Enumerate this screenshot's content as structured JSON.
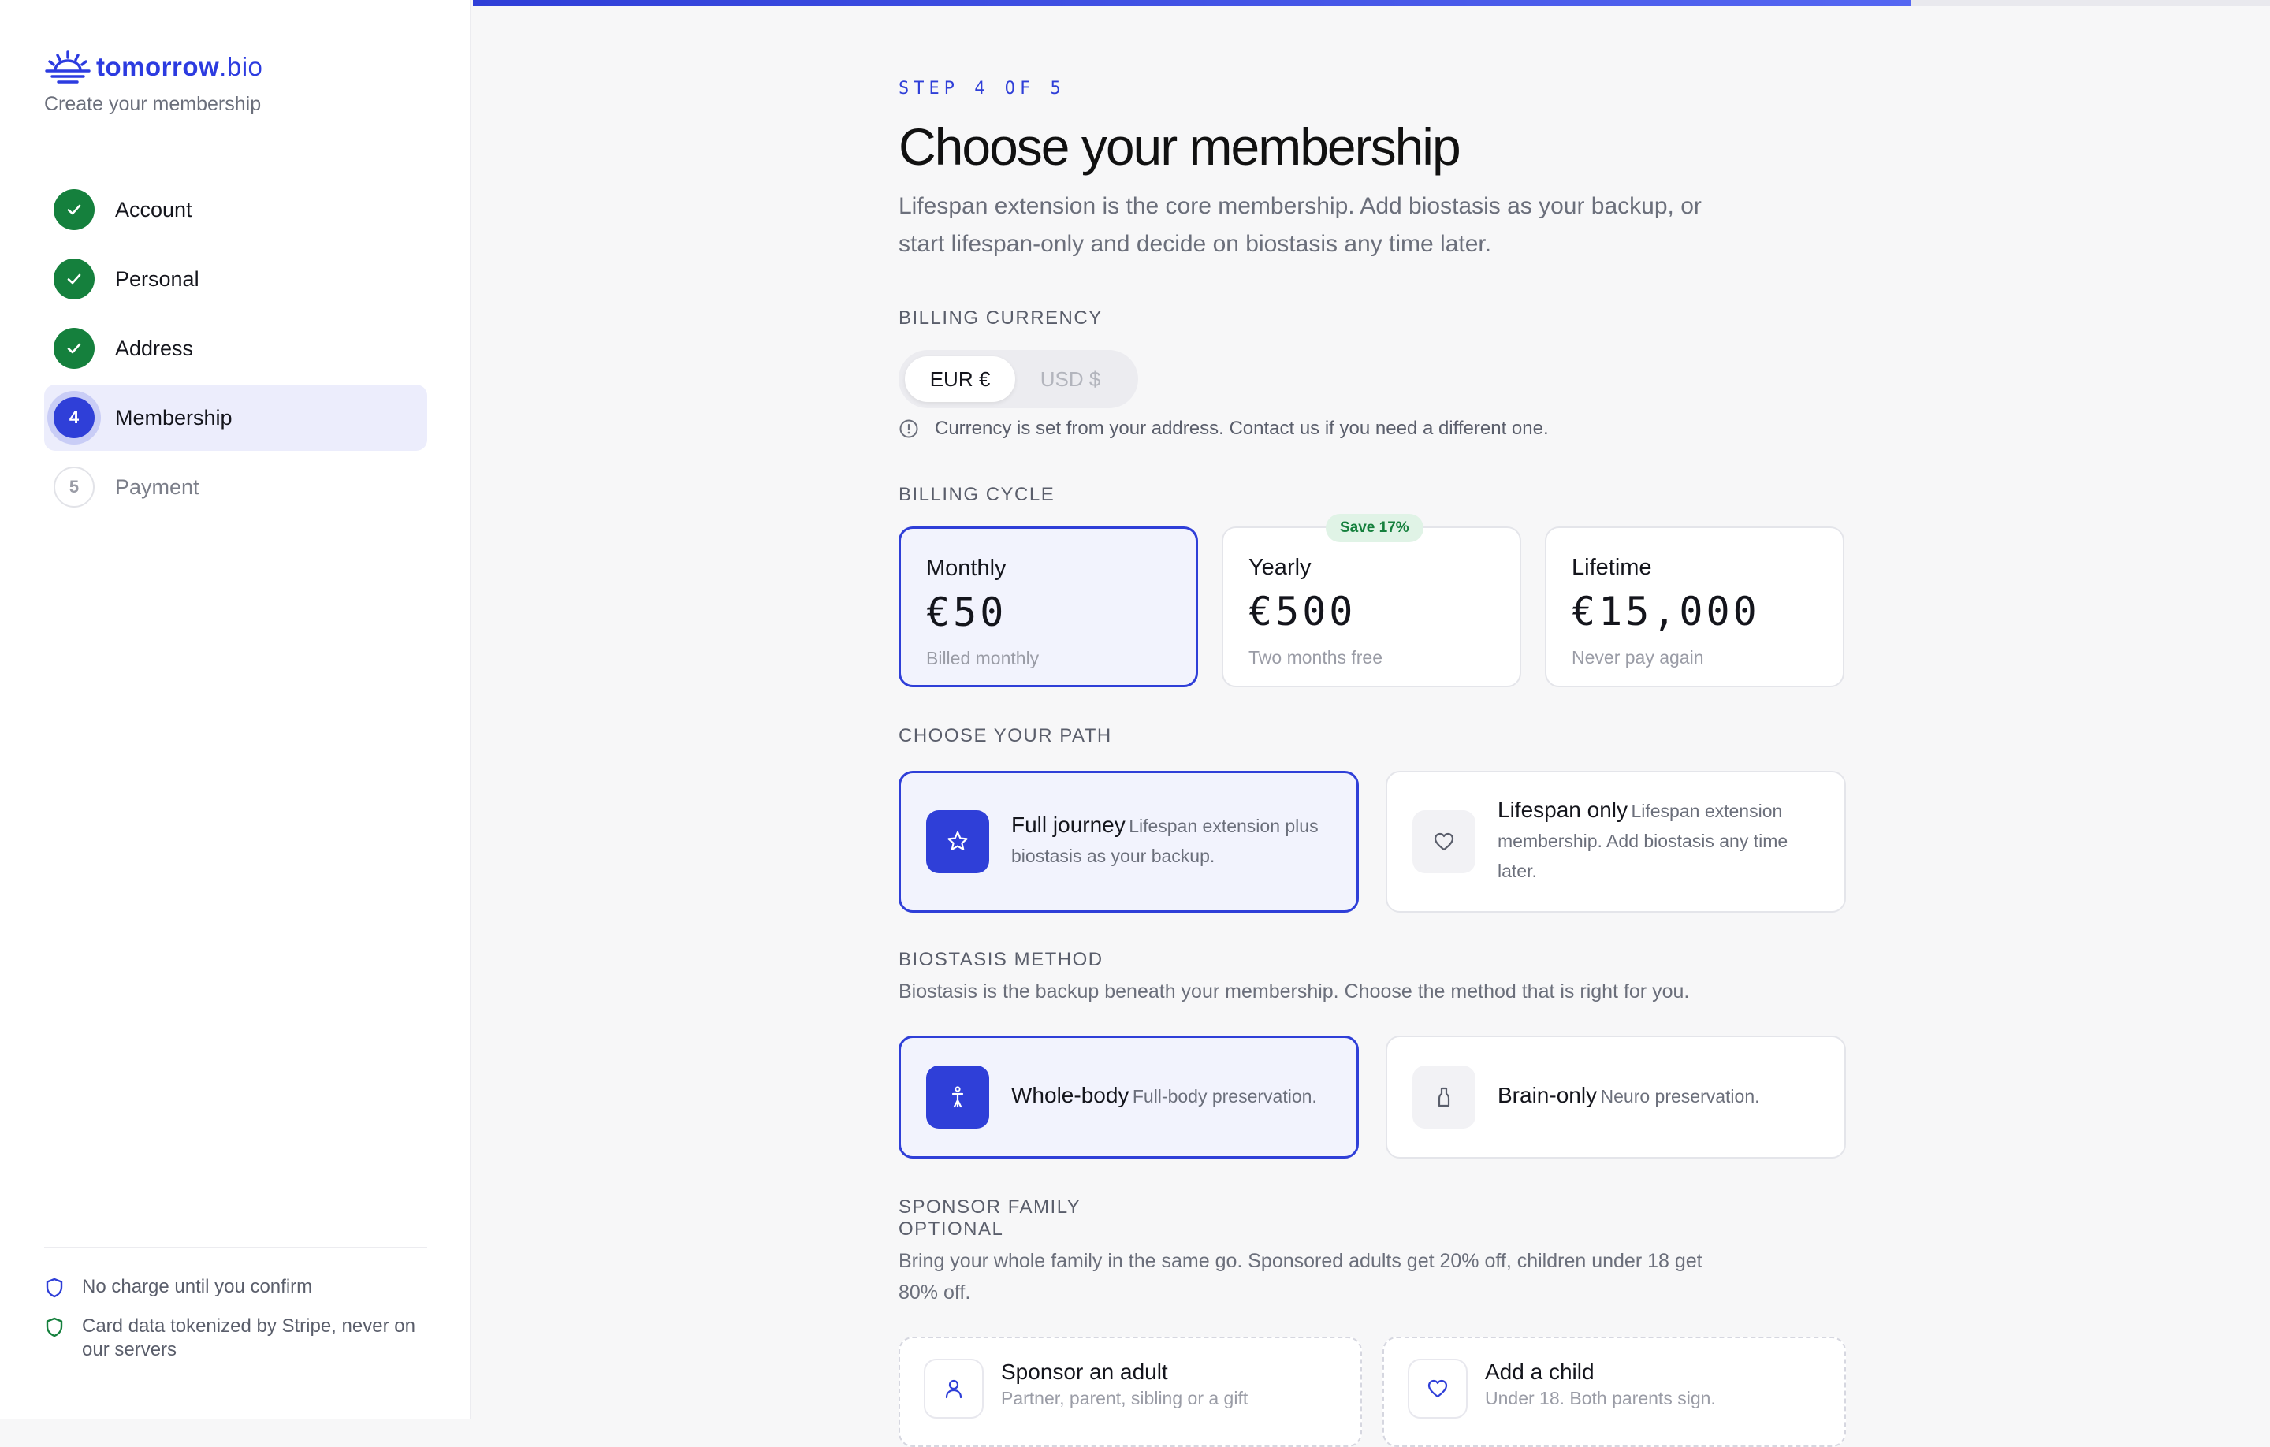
{
  "brand": {
    "name_bold": "tomorrow",
    "name_suffix": ".bio",
    "subtitle": "Create your membership"
  },
  "steps": [
    {
      "badge": "",
      "label": "Account",
      "state": "done"
    },
    {
      "badge": "",
      "label": "Personal",
      "state": "done"
    },
    {
      "badge": "",
      "label": "Address",
      "state": "done"
    },
    {
      "badge": "4",
      "label": "Membership",
      "state": "current"
    },
    {
      "badge": "5",
      "label": "Payment",
      "state": "todo"
    }
  ],
  "sidebar_footer": {
    "no_charge": "No charge until you confirm",
    "stripe": "Card data tokenized by Stripe, never on our servers"
  },
  "progress": {
    "fraction": 0.8,
    "fill_color": "#2f3fd8"
  },
  "header": {
    "eyebrow": "STEP 4 OF 5",
    "title": "Choose your membership",
    "lede": "Lifespan extension is the core membership. Add biostasis as your backup, or start lifespan-only and decide on biostasis any time later."
  },
  "currency": {
    "label": "BILLING CURRENCY",
    "options": [
      {
        "label": "EUR €",
        "state": "selected"
      },
      {
        "label": "USD $",
        "state": "disabled"
      }
    ],
    "note": "Currency is set from your address. Contact us if you need a different one."
  },
  "billing_cycle": {
    "label": "BILLING CYCLE",
    "options": [
      {
        "name": "Monthly",
        "price": "€50",
        "sub": "Billed monthly",
        "selected": true,
        "pill": ""
      },
      {
        "name": "Yearly",
        "price": "€500",
        "sub": "Two months free",
        "selected": false,
        "pill": "Save 17%"
      },
      {
        "name": "Lifetime",
        "price": "€15,000",
        "sub": "Never pay again",
        "selected": false,
        "pill": ""
      }
    ]
  },
  "path": {
    "label": "CHOOSE YOUR PATH",
    "options": [
      {
        "name": "Full journey",
        "desc": "Lifespan extension plus biostasis as your backup.",
        "icon": "star-icon",
        "selected": true
      },
      {
        "name": "Lifespan only",
        "desc": "Lifespan extension membership. Add biostasis any time later.",
        "icon": "heart-icon",
        "selected": false
      }
    ]
  },
  "biostasis": {
    "label": "BIOSTASIS METHOD",
    "desc": "Biostasis is the backup beneath your membership. Choose the method that is right for you.",
    "options": [
      {
        "name": "Whole-body",
        "desc": "Full-body preservation.",
        "icon": "body-icon",
        "selected": true
      },
      {
        "name": "Brain-only",
        "desc": "Neuro preservation.",
        "icon": "head-icon",
        "selected": false
      }
    ]
  },
  "sponsor": {
    "label": "SPONSOR FAMILY",
    "optional": "OPTIONAL",
    "desc": "Bring your whole family in the same go. Sponsored adults get 20% off, children under 18 get 80% off.",
    "options": [
      {
        "name": "Sponsor an adult",
        "desc": "Partner, parent, sibling or a gift",
        "icon": "person-icon"
      },
      {
        "name": "Add a child",
        "desc": "Under 18. Both parents sign.",
        "icon": "heart-icon"
      }
    ]
  },
  "colors": {
    "accent": "#2f3fd8",
    "success": "#15803d",
    "muted": "#6b6f7b"
  }
}
